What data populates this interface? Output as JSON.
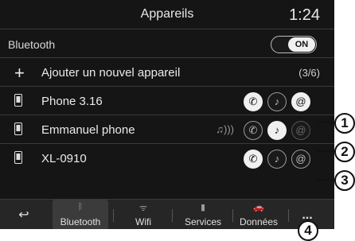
{
  "header": {
    "title": "Appareils",
    "clock": "1:24"
  },
  "bluetooth": {
    "label": "Bluetooth",
    "toggle": "ON"
  },
  "add_device": {
    "label": "Ajouter un nouvel appareil",
    "count": "(3/6)"
  },
  "devices": [
    {
      "name": "Phone 3.16"
    },
    {
      "name": "Emmanuel phone"
    },
    {
      "name": "XL-0910"
    }
  ],
  "tabs": [
    {
      "label": "Bluetooth",
      "active": true
    },
    {
      "label": "Wifi"
    },
    {
      "label": "Services"
    },
    {
      "label": "Données"
    },
    {
      "label": "..."
    }
  ],
  "callouts": [
    "1",
    "2",
    "3",
    "4"
  ]
}
